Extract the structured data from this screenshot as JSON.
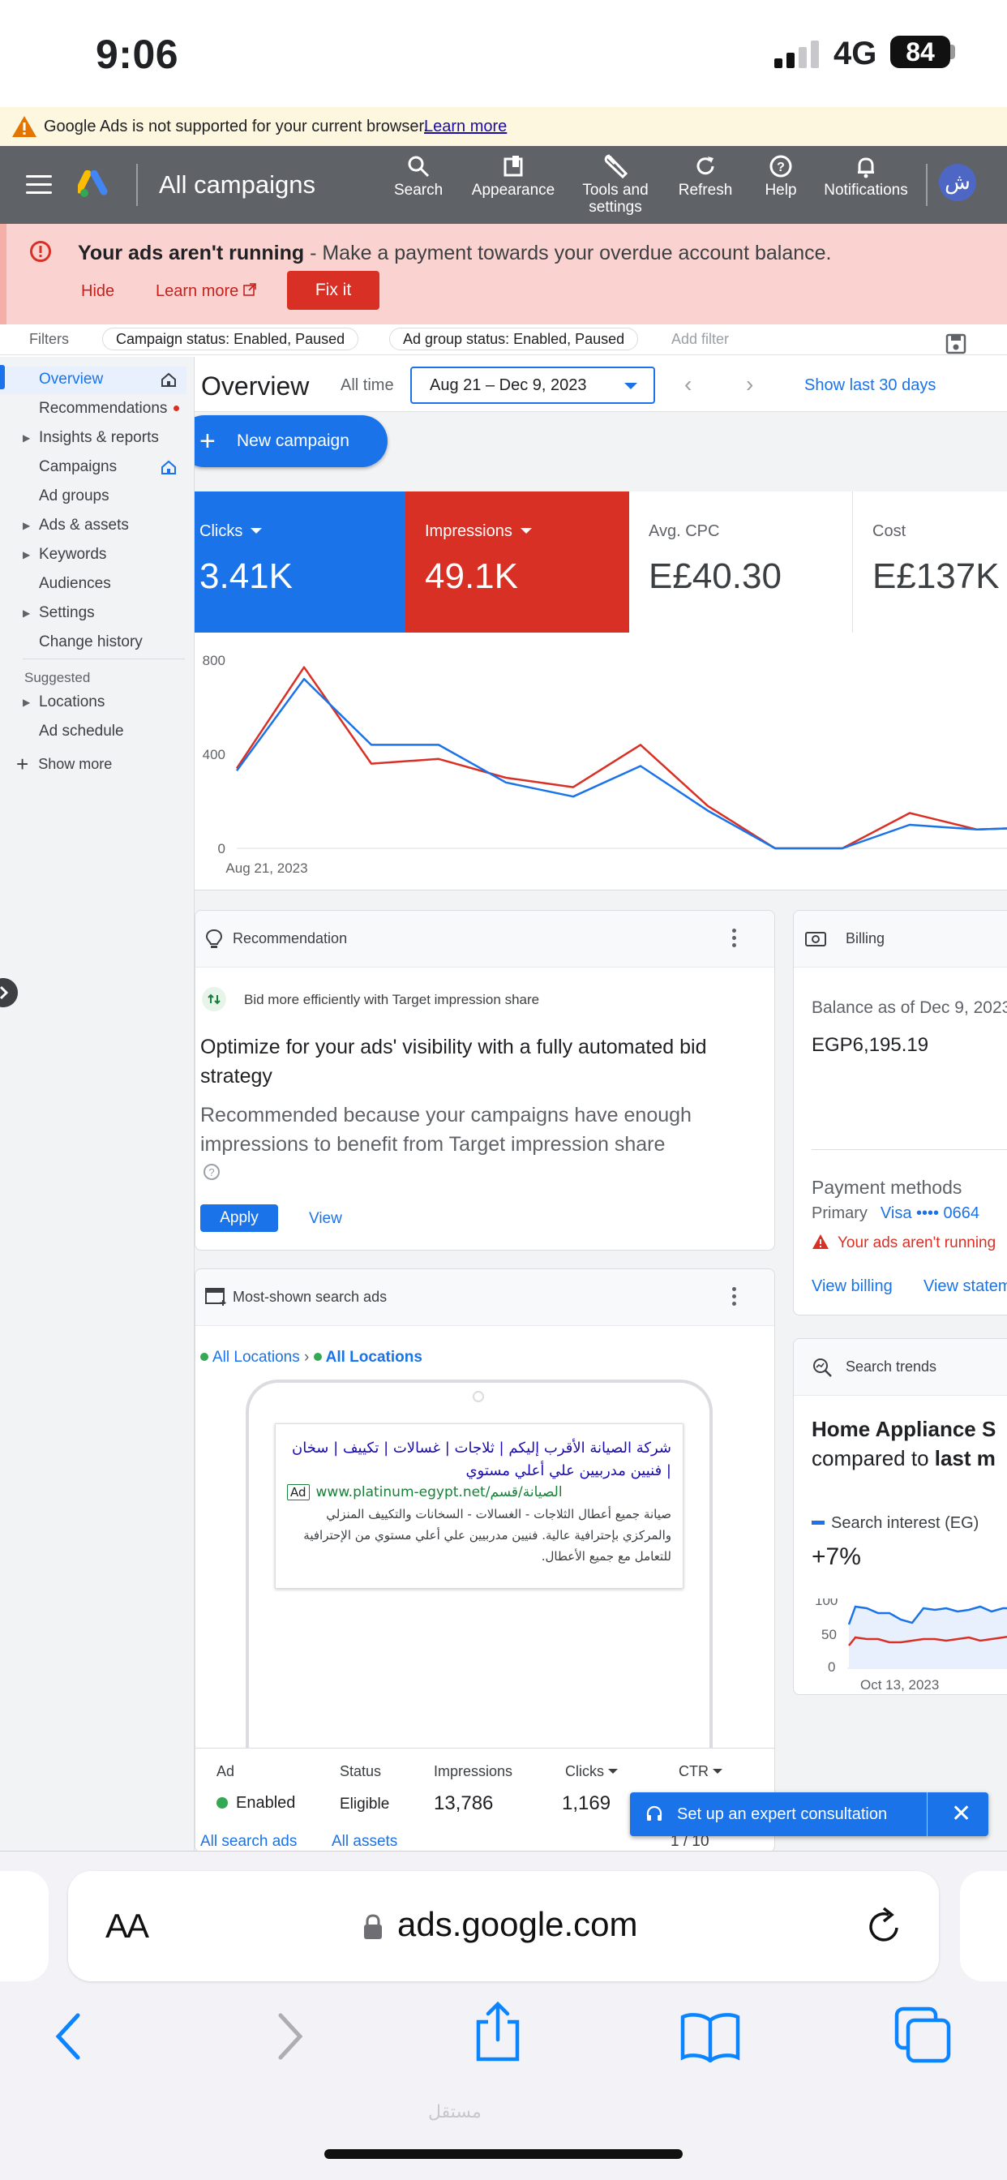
{
  "status_bar": {
    "time": "9:06",
    "network": "4G",
    "battery": "84"
  },
  "browser_warning": {
    "text": "Google Ads is not supported for your current browser.",
    "link": "Learn more"
  },
  "header": {
    "title": "All campaigns",
    "tools": [
      {
        "label": "Search",
        "icon": "search-icon"
      },
      {
        "label": "Appearance",
        "icon": "appearance-icon"
      },
      {
        "label": "Tools and settings",
        "icon": "wrench-icon"
      },
      {
        "label": "Refresh",
        "icon": "refresh-icon"
      },
      {
        "label": "Help",
        "icon": "help-icon"
      },
      {
        "label": "Notifications",
        "icon": "bell-icon"
      }
    ],
    "avatar_letter": "ش"
  },
  "alert": {
    "title": "Your ads aren't running",
    "message": " - Make a payment towards your overdue account balance.",
    "hide": "Hide",
    "learn_more": "Learn more",
    "fix": "Fix it"
  },
  "filters": {
    "label": "Filters",
    "chips": [
      "Campaign status: Enabled, Paused",
      "Ad group status: Enabled, Paused"
    ],
    "add": "Add filter"
  },
  "sidebar": {
    "items": [
      {
        "label": "Overview",
        "active": true
      },
      {
        "label": "Recommendations"
      },
      {
        "label": "Insights & reports"
      },
      {
        "label": "Campaigns"
      },
      {
        "label": "Ad groups"
      },
      {
        "label": "Ads & assets"
      },
      {
        "label": "Keywords"
      },
      {
        "label": "Audiences"
      },
      {
        "label": "Settings"
      },
      {
        "label": "Change history"
      }
    ],
    "suggested_label": "Suggested",
    "suggested": [
      {
        "label": "Locations"
      },
      {
        "label": "Ad schedule"
      }
    ],
    "show_more": "Show more"
  },
  "overview": {
    "title": "Overview",
    "all_time": "All time",
    "date_range": "Aug 21 – Dec 9, 2023",
    "show_last": "Show last 30 days",
    "new_campaign": "New campaign"
  },
  "metrics": [
    {
      "label": "Clicks",
      "value": "3.41K",
      "color": "#1a73e8"
    },
    {
      "label": "Impressions",
      "value": "49.1K",
      "color": "#d93025"
    },
    {
      "label": "Avg. CPC",
      "value": "E£40.30"
    },
    {
      "label": "Cost",
      "value": "E£137K"
    }
  ],
  "chart_data": {
    "type": "line",
    "x": [
      "Aug 21, 2023",
      "",
      "",
      "",
      "",
      "",
      "",
      "",
      "",
      "",
      "",
      "",
      ""
    ],
    "x_tick_label": "Aug 21, 2023",
    "yticks": [
      0,
      400,
      800
    ],
    "ylim": [
      0,
      800
    ],
    "series": [
      {
        "name": "Clicks",
        "color": "#1a73e8",
        "values": [
          330,
          720,
          440,
          440,
          280,
          220,
          350,
          160,
          0,
          0,
          100,
          80,
          90
        ]
      },
      {
        "name": "Impressions",
        "color": "#d93025",
        "values": [
          340,
          770,
          360,
          380,
          300,
          260,
          440,
          180,
          0,
          0,
          150,
          80,
          90
        ]
      }
    ]
  },
  "recommendation": {
    "card_title": "Recommendation",
    "subtitle": "Bid more efficiently with Target impression share",
    "headline": "Optimize for your ads' visibility with a fully automated bid strategy",
    "body": "Recommended because your campaigns have enough impressions to benefit from Target impression share",
    "apply": "Apply",
    "view": "View"
  },
  "billing": {
    "card_title": "Billing",
    "balance_label": "Balance as of Dec 9, 2023",
    "balance": "EGP6,195.19",
    "payment_methods": "Payment methods",
    "primary": "Primary",
    "visa": "Visa •••• 0664",
    "error": "Your ads aren't running",
    "view_billing": "View billing",
    "view_statements": "View statements"
  },
  "search_ads": {
    "card_title": "Most-shown search ads",
    "loc_1": "All Locations",
    "loc_sep": "›",
    "loc_2": "All Locations",
    "ad_headline": "شركة الصيانة الأقرب إليكم | ثلاجات | غسالات | تكييف | سخان | فنيين مدربيين علي أعلي مستوي",
    "ad_tag": "Ad",
    "ad_url": "www.platinum-egypt.net/الصيانة/قسم",
    "ad_description": "صيانة جميع أعطال الثلاجات - الغسالات - السخانات والتكييف المنزلي والمركزي بإحترافية عالية. فنيين مدربيين علي أعلي مستوي من الإحترافية للتعامل مع جميع الأعطال.",
    "table": {
      "headers": [
        "Ad",
        "Status",
        "Impressions",
        "Clicks",
        "CTR"
      ],
      "row": {
        "ad": "Enabled",
        "status": "Eligible",
        "impressions": "13,786",
        "clicks": "1,169"
      },
      "footer_1": "All search ads",
      "footer_2": "All assets",
      "pager": "1 / 10"
    }
  },
  "search_trends": {
    "card_title": "Search trends",
    "headline_1": "Home Appliance S",
    "headline_2_pre": "compared to ",
    "headline_2_bold": "last m",
    "legend": "Search interest (EG)",
    "change": "+7%",
    "yticks": [
      "100",
      "50",
      "0"
    ],
    "x_label": "Oct 13, 2023"
  },
  "toast": {
    "label": "Set up an expert consultation"
  },
  "safari": {
    "aa": "AA",
    "url": "ads.google.com"
  }
}
